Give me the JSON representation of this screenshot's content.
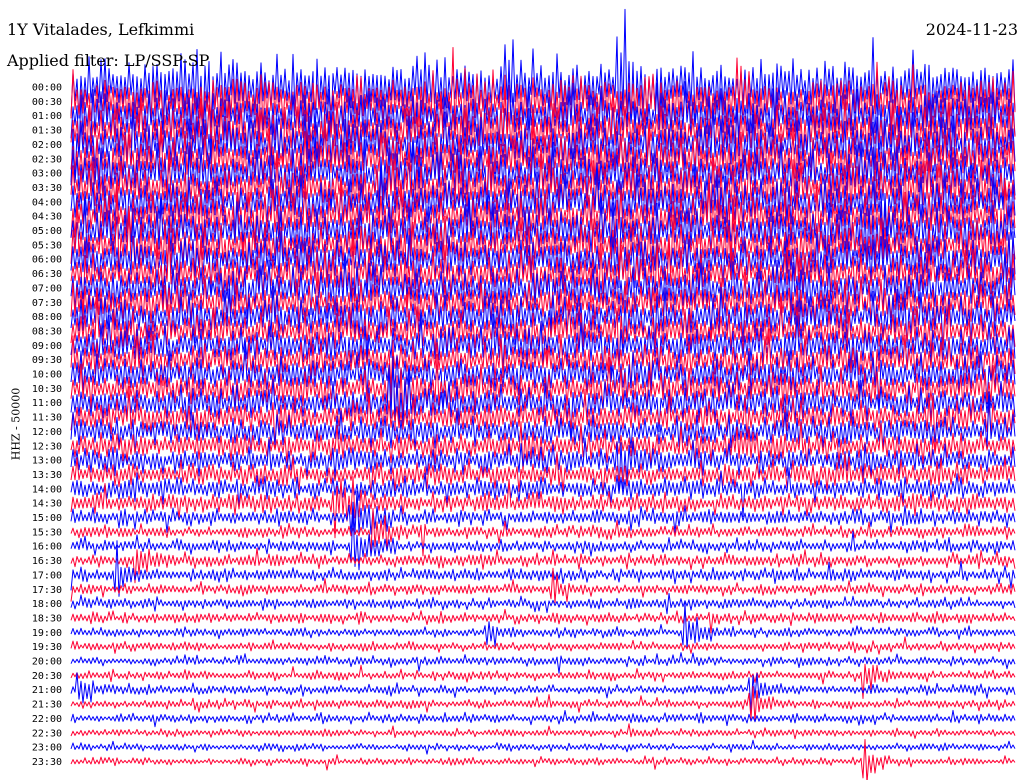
{
  "header": {
    "station": "1Y Vitalades, Lefkimmi",
    "date": "2024-11-23",
    "filter": "Applied filter: LP/SSP-SP"
  },
  "channel_label": "HHZ - 50000",
  "chart_data": {
    "type": "line",
    "title": "1Y Vitalades, Lefkimmi",
    "subtitle": "2024-11-23",
    "ylabel": "HHZ - 50000",
    "xlabel": "",
    "row_labels": [
      "00:00",
      "00:30",
      "01:00",
      "01:30",
      "02:00",
      "02:30",
      "03:00",
      "03:30",
      "04:00",
      "04:30",
      "05:00",
      "05:30",
      "06:00",
      "06:30",
      "07:00",
      "07:30",
      "08:00",
      "08:30",
      "09:00",
      "09:30",
      "10:00",
      "10:30",
      "11:00",
      "11:30",
      "12:00",
      "12:30",
      "13:00",
      "13:30",
      "14:00",
      "14:30",
      "15:00",
      "15:30",
      "16:00",
      "16:30",
      "17:00",
      "17:30",
      "18:00",
      "18:30",
      "19:00",
      "19:30",
      "20:00",
      "20:30",
      "21:00",
      "21:30",
      "22:00",
      "22:30",
      "23:00",
      "23:30"
    ],
    "trace_colors": [
      "#0000ff",
      "#ff0033"
    ],
    "noise_amplitude": [
      30,
      28,
      27,
      26,
      26,
      25,
      25,
      25,
      24,
      24,
      24,
      23,
      23,
      22,
      22,
      21,
      21,
      20,
      20,
      19,
      19,
      18,
      18,
      17,
      16,
      15,
      14,
      13,
      12,
      11,
      9,
      7,
      7,
      7,
      7,
      6,
      6,
      6,
      5,
      5,
      5,
      5,
      5,
      5,
      5,
      4,
      4,
      4
    ],
    "events": [
      {
        "row": 0,
        "position": 0.58,
        "amplitude": 60
      },
      {
        "row": 4,
        "position": 0.25,
        "amplitude": 25
      },
      {
        "row": 10,
        "position": 0.84,
        "amplitude": 30
      },
      {
        "row": 21,
        "position": 0.34,
        "amplitude": 25
      },
      {
        "row": 22,
        "position": 0.34,
        "amplitude": 30
      },
      {
        "row": 25,
        "position": 0.48,
        "amplitude": 20
      },
      {
        "row": 26,
        "position": 0.58,
        "amplitude": 20
      },
      {
        "row": 29,
        "position": 0.28,
        "amplitude": 25
      },
      {
        "row": 30,
        "position": 0.3,
        "amplitude": 30
      },
      {
        "row": 31,
        "position": 0.32,
        "amplitude": 25
      },
      {
        "row": 32,
        "position": 0.3,
        "amplitude": 22
      },
      {
        "row": 33,
        "position": 0.07,
        "amplitude": 18
      },
      {
        "row": 34,
        "position": 0.05,
        "amplitude": 20
      },
      {
        "row": 35,
        "position": 0.51,
        "amplitude": 14
      },
      {
        "row": 38,
        "position": 0.44,
        "amplitude": 14
      },
      {
        "row": 38,
        "position": 0.65,
        "amplitude": 28
      },
      {
        "row": 41,
        "position": 0.84,
        "amplitude": 16
      },
      {
        "row": 42,
        "position": 0.01,
        "amplitude": 18
      },
      {
        "row": 42,
        "position": 0.72,
        "amplitude": 20
      },
      {
        "row": 43,
        "position": 0.72,
        "amplitude": 20
      },
      {
        "row": 47,
        "position": 0.84,
        "amplitude": 16
      }
    ]
  }
}
